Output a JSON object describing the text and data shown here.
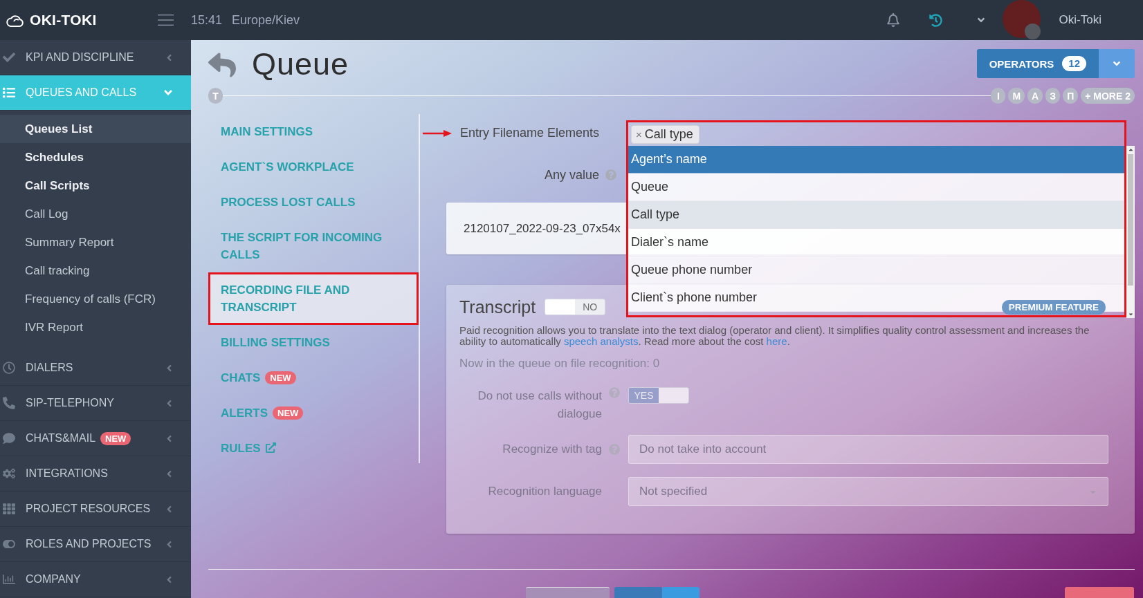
{
  "topbar": {
    "logo": "OKI-TOKI",
    "time": "15:41",
    "timezone": "Europe/Kiev",
    "user": "Oki-Toki"
  },
  "sidebar": {
    "items": [
      {
        "label": "KPI AND DISCIPLINE",
        "selected": false,
        "expanded": false
      },
      {
        "label": "QUEUES AND CALLS",
        "selected": true,
        "expanded": true,
        "children": [
          {
            "label": "Queues List",
            "selected": true,
            "emphasized": true
          },
          {
            "label": "Schedules",
            "selected": false,
            "emphasized": true
          },
          {
            "label": "Call Scripts",
            "selected": false,
            "emphasized": true
          },
          {
            "label": "Call Log",
            "selected": false,
            "emphasized": false
          },
          {
            "label": "Summary Report",
            "selected": false,
            "emphasized": false
          },
          {
            "label": "Call tracking",
            "selected": false,
            "emphasized": false
          },
          {
            "label": "Frequency of calls (FCR)",
            "selected": false,
            "emphasized": false
          },
          {
            "label": "IVR Report",
            "selected": false,
            "emphasized": false
          }
        ]
      },
      {
        "label": "DIALERS",
        "selected": false,
        "expanded": false
      },
      {
        "label": "SIP-TELEPHONY",
        "selected": false,
        "expanded": false
      },
      {
        "label": "CHATS&MAIL",
        "selected": false,
        "expanded": false,
        "badge": "NEW"
      },
      {
        "label": "INTEGRATIONS",
        "selected": false,
        "expanded": false
      },
      {
        "label": "PROJECT RESOURCES",
        "selected": false,
        "expanded": false
      },
      {
        "label": "ROLES AND PROJECTS",
        "selected": false,
        "expanded": false
      },
      {
        "label": "COMPANY",
        "selected": false,
        "expanded": false
      }
    ]
  },
  "header": {
    "title": "Queue",
    "operators_button": {
      "label": "OPERATORS",
      "count": "12"
    },
    "timeline_start": "T",
    "operators": [
      "I",
      "M",
      "A",
      "З",
      "П"
    ],
    "more": "+ MORE 2"
  },
  "settings_nav": [
    {
      "label": "MAIN SETTINGS",
      "selected": false,
      "annotated": false,
      "external": false
    },
    {
      "label": "AGENT`S WORKPLACE",
      "selected": false,
      "annotated": false,
      "external": false
    },
    {
      "label": "PROCESS LOST CALLS",
      "selected": false,
      "annotated": false,
      "external": false
    },
    {
      "label": "THE SCRIPT FOR INCOMING CALLS",
      "selected": false,
      "annotated": false,
      "external": false
    },
    {
      "label": "RECORDING FILE AND TRANSCRIPT",
      "selected": true,
      "annotated": true,
      "external": false
    },
    {
      "label": "BILLING SETTINGS",
      "selected": false,
      "annotated": false,
      "external": false
    },
    {
      "label": "CHATS",
      "selected": false,
      "annotated": false,
      "external": false,
      "badge": "NEW"
    },
    {
      "label": "ALERTS",
      "selected": false,
      "annotated": false,
      "external": false,
      "badge": "NEW"
    },
    {
      "label": "RULES",
      "selected": false,
      "annotated": false,
      "external": true
    }
  ],
  "filename_elements": {
    "label": "Entry Filename Elements",
    "annotated": true,
    "tags": [
      {
        "label": "Call type",
        "remove": "×"
      }
    ],
    "dropdown": {
      "annotated": true,
      "options": [
        {
          "label": "Agent’s name",
          "highlighted": true,
          "selected": false
        },
        {
          "label": "Queue",
          "highlighted": false,
          "selected": false
        },
        {
          "label": "Call type",
          "highlighted": false,
          "selected": true
        },
        {
          "label": "Dialer`s name",
          "highlighted": false,
          "selected": false
        },
        {
          "label": "Queue phone number",
          "highlighted": false,
          "selected": false
        },
        {
          "label": "Client`s phone number",
          "highlighted": false,
          "selected": false
        }
      ]
    },
    "any_value": {
      "label": "Any value",
      "help": true
    },
    "preview": "2120107_2022-09-23_07x54x"
  },
  "transcript": {
    "title": "Transcript",
    "toggle": {
      "on": false,
      "label": "NO"
    },
    "badge": "PREMIUM FEATURE",
    "description": [
      {
        "text": "Paid recognition allows you to translate into the text dialog (operator and client). It simplifies quality control assessment and increases the ability to automatically ",
        "link": false
      },
      {
        "text": "speech analysts",
        "link": true
      },
      {
        "text": ". Read more about the cost ",
        "link": false
      },
      {
        "text": "here",
        "link": true
      },
      {
        "text": ".",
        "link": false
      }
    ],
    "queue_status": "Now in the queue on file recognition: 0",
    "fields": [
      {
        "kind": "toggle",
        "label": "Do not use calls without dialogue",
        "help": true,
        "disabled": true,
        "on": true,
        "value": "YES"
      },
      {
        "kind": "input",
        "label": "Recognize with tag",
        "help": true,
        "disabled": true,
        "placeholder": "Do not take into account"
      },
      {
        "kind": "select",
        "label": "Recognition language",
        "help": false,
        "disabled": true,
        "value": "Not specified"
      }
    ]
  }
}
